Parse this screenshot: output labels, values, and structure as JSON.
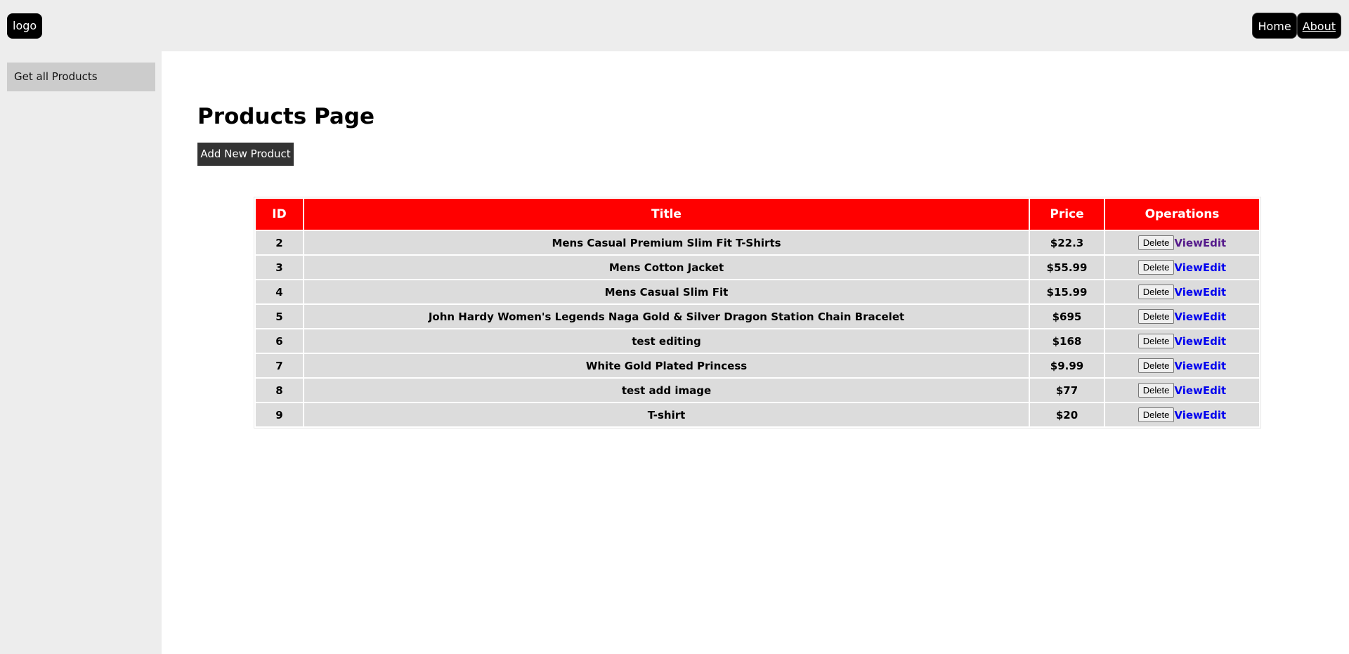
{
  "header": {
    "logo": "logo",
    "nav": {
      "home": "Home",
      "about": "About"
    }
  },
  "sidebar": {
    "items": [
      {
        "label": "Get all Products"
      }
    ]
  },
  "main": {
    "title": "Products Page",
    "add_button": "Add New Product",
    "table": {
      "headers": {
        "id": "ID",
        "title": "Title",
        "price": "Price",
        "operations": "Operations"
      },
      "rows": [
        {
          "id": "2",
          "title": "Mens Casual Premium Slim Fit T-Shirts",
          "price": "$22.3"
        },
        {
          "id": "3",
          "title": "Mens Cotton Jacket",
          "price": "$55.99"
        },
        {
          "id": "4",
          "title": "Mens Casual Slim Fit",
          "price": "$15.99"
        },
        {
          "id": "5",
          "title": "John Hardy Women's Legends Naga Gold & Silver Dragon Station Chain Bracelet",
          "price": "$695"
        },
        {
          "id": "6",
          "title": "test editing",
          "price": "$168"
        },
        {
          "id": "7",
          "title": "White Gold Plated Princess",
          "price": "$9.99"
        },
        {
          "id": "8",
          "title": "test add image",
          "price": "$77"
        },
        {
          "id": "9",
          "title": "T-shirt",
          "price": "$20"
        }
      ],
      "actions": {
        "delete": "Delete",
        "view": "View",
        "edit": "Edit"
      }
    }
  },
  "colors": {
    "header_bg": "#ff0000",
    "row_bg": "#dcdcdc",
    "link": "#0000ee",
    "visited_link": "#551a8b",
    "button_dark": "#333333"
  }
}
